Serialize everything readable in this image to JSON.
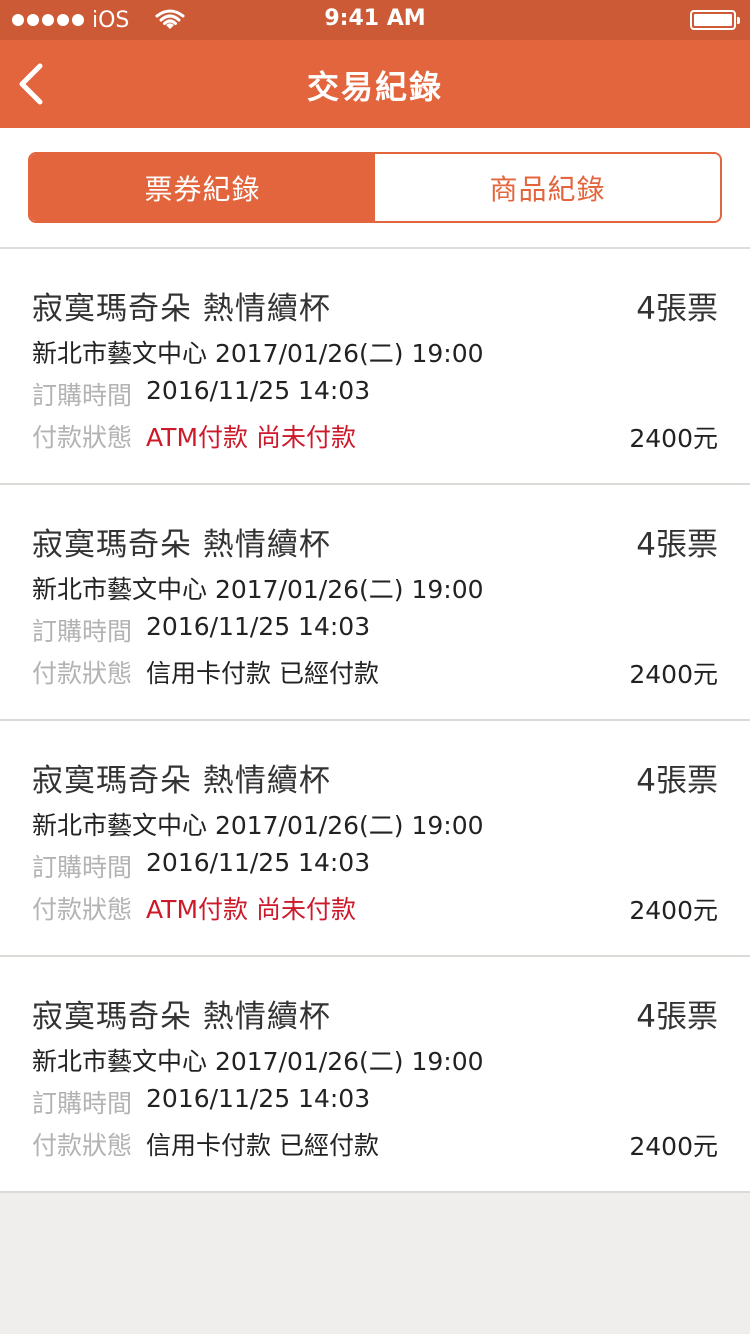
{
  "status_bar": {
    "carrier": "iOS",
    "time": "9:41 AM"
  },
  "nav": {
    "title": "交易紀錄"
  },
  "tabs": [
    {
      "label": "票券紀錄",
      "active": true
    },
    {
      "label": "商品紀錄",
      "active": false
    }
  ],
  "colors": {
    "accent": "#e3653d",
    "status_bar": "#cd5a36",
    "unpaid": "#cc1a2b"
  },
  "icons": [
    "back-chevron-icon",
    "wifi-icon",
    "battery-icon",
    "signal-dots-icon"
  ],
  "records": [
    {
      "title": "寂寞瑪奇朵  熱情續杯",
      "qty": "4張票",
      "venue": "新北市藝文中心  2017/01/26(二) 19:00",
      "order_label": "訂購時間",
      "order_time": "2016/11/25 14:03",
      "pay_label": "付款狀態",
      "pay_status": "ATM付款 尚未付款",
      "unpaid": true,
      "price": "2400元"
    },
    {
      "title": "寂寞瑪奇朵  熱情續杯",
      "qty": "4張票",
      "venue": "新北市藝文中心  2017/01/26(二) 19:00",
      "order_label": "訂購時間",
      "order_time": "2016/11/25 14:03",
      "pay_label": "付款狀態",
      "pay_status": "信用卡付款 已經付款",
      "unpaid": false,
      "price": "2400元"
    },
    {
      "title": "寂寞瑪奇朵  熱情續杯",
      "qty": "4張票",
      "venue": "新北市藝文中心  2017/01/26(二) 19:00",
      "order_label": "訂購時間",
      "order_time": "2016/11/25 14:03",
      "pay_label": "付款狀態",
      "pay_status": "ATM付款 尚未付款",
      "unpaid": true,
      "price": "2400元"
    },
    {
      "title": "寂寞瑪奇朵  熱情續杯",
      "qty": "4張票",
      "venue": "新北市藝文中心  2017/01/26(二) 19:00",
      "order_label": "訂購時間",
      "order_time": "2016/11/25 14:03",
      "pay_label": "付款狀態",
      "pay_status": "信用卡付款 已經付款",
      "unpaid": false,
      "price": "2400元"
    }
  ]
}
